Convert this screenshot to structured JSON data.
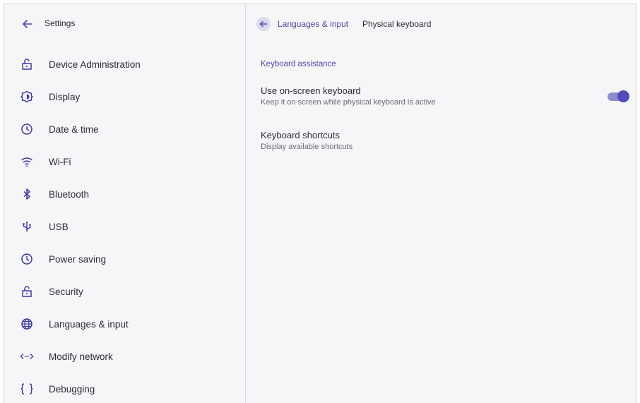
{
  "sidebar": {
    "title": "Settings",
    "items": [
      {
        "label": "Device Administration",
        "icon": "unlock-icon"
      },
      {
        "label": "Display",
        "icon": "brightness-icon"
      },
      {
        "label": "Date & time",
        "icon": "clock-icon"
      },
      {
        "label": "Wi-Fi",
        "icon": "wifi-icon"
      },
      {
        "label": "Bluetooth",
        "icon": "bluetooth-icon"
      },
      {
        "label": "USB",
        "icon": "usb-icon"
      },
      {
        "label": "Power saving",
        "icon": "clock-icon"
      },
      {
        "label": "Security",
        "icon": "unlock-icon"
      },
      {
        "label": "Languages & input",
        "icon": "globe-icon"
      },
      {
        "label": "Modify network",
        "icon": "network-icon"
      },
      {
        "label": "Debugging",
        "icon": "braces-icon"
      }
    ]
  },
  "header": {
    "parent": "Languages & input",
    "current": "Physical keyboard"
  },
  "main": {
    "section_title": "Keyboard assistance",
    "prefs": [
      {
        "title": "Use on-screen keyboard",
        "summary": "Keep it on screen while physical keyboard is active",
        "toggle": true
      },
      {
        "title": "Keyboard shortcuts",
        "summary": "Display available shortcuts"
      }
    ]
  },
  "colors": {
    "accent": "#4f4bb8",
    "accent_light": "#8f8bd0",
    "background": "#f6f6f8"
  }
}
